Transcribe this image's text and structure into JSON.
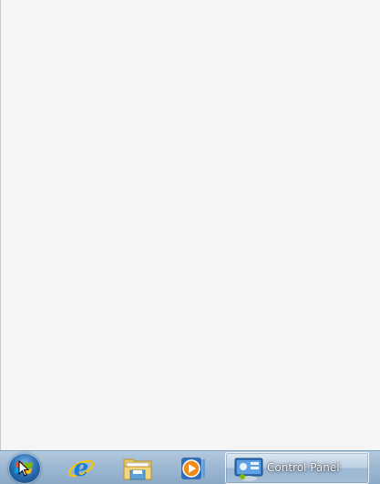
{
  "taskbar": {
    "start": {
      "icon": "windows-logo-icon"
    },
    "pinned": [
      {
        "icon": "internet-explorer-icon"
      },
      {
        "icon": "windows-explorer-icon"
      },
      {
        "icon": "media-player-icon"
      }
    ],
    "open_window": {
      "icon": "control-panel-icon",
      "label": "Control Panel"
    }
  },
  "colors": {
    "desktop_bg": "#f5f5f5",
    "taskbar": "#9fb9d3"
  }
}
